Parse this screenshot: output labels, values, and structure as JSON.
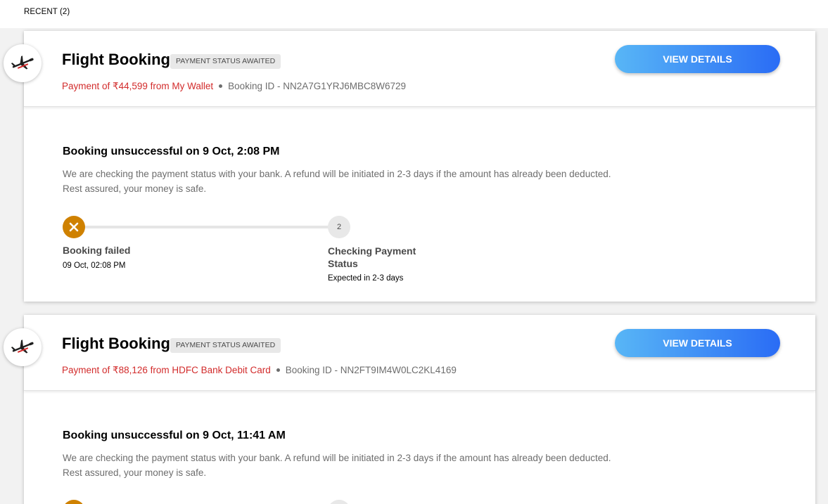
{
  "section": {
    "title": "RECENT (2)"
  },
  "bookings": [
    {
      "type_icon": "airplane-icon",
      "title": "Flight Booking",
      "status": "PAYMENT STATUS AWAITED",
      "payment_text": "Payment of ₹44,599 from My Wallet",
      "booking_label": "Booking ID",
      "booking_id": "NN2A7G1YRJ6MBC8W6729",
      "button_label": "VIEW DETAILS",
      "result_title": "Booking unsuccessful on 9 Oct, 2:08 PM",
      "description_line1": "We are checking the payment status with your bank. A refund will be initiated in 2-3 days if the amount has already been deducted.",
      "description_line2": "Rest assured, your money is safe.",
      "steps": [
        {
          "icon": "close-icon",
          "title": "Booking failed",
          "subtitle": "09 Oct, 02:08 PM"
        },
        {
          "number": "2",
          "title": "Checking Payment Status",
          "subtitle": "Expected in 2-3 days"
        }
      ]
    },
    {
      "type_icon": "airplane-icon",
      "title": "Flight Booking",
      "status": "PAYMENT STATUS AWAITED",
      "payment_text": "Payment of ₹88,126 from HDFC Bank Debit Card",
      "booking_label": "Booking ID",
      "booking_id": "NN2FT9IM4W0LC2KL4169",
      "button_label": "VIEW DETAILS",
      "result_title": "Booking unsuccessful on 9 Oct, 11:41 AM",
      "description_line1": "We are checking the payment status with your bank. A refund will be initiated in 2-3 days if the amount has already been deducted.",
      "description_line2": "Rest assured, your money is safe."
    }
  ],
  "colors": {
    "payment_text": "#d22b2b",
    "step_failed": "#cf8100",
    "button_start": "#58b6f6",
    "button_end": "#2a6cf5"
  }
}
